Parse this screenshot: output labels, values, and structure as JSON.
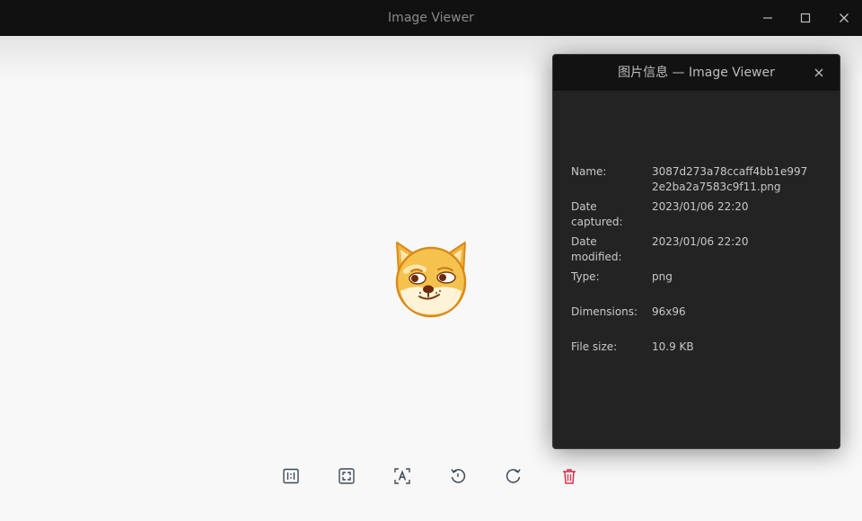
{
  "window": {
    "title": "Image Viewer"
  },
  "info_panel": {
    "title": "图片信息 — Image Viewer",
    "rows": [
      {
        "label": "Name:",
        "value": "3087d273a78ccaff4bb1e9972e2ba2a7583c9f11.png"
      },
      {
        "label": "Date captured:",
        "value": "2023/01/06 22:20"
      },
      {
        "label": "Date modified:",
        "value": "2023/01/06 22:20"
      },
      {
        "label": "Type:",
        "value": "png"
      },
      {
        "label": "Dimensions:",
        "value": "96x96"
      },
      {
        "label": "File size:",
        "value": "10.9 KB"
      }
    ]
  },
  "toolbar": {
    "icons": [
      "original-size-icon",
      "fit-window-icon",
      "ocr-icon",
      "rotate-counterclockwise-icon",
      "rotate-clockwise-icon",
      "delete-icon"
    ]
  },
  "colors": {
    "titlebar_bg": "#111111",
    "panel_bg": "#232323",
    "viewer_bg": "#f8f8f8",
    "delete_red": "#d9304a",
    "toolbar_icon": "#3c4a5a"
  }
}
